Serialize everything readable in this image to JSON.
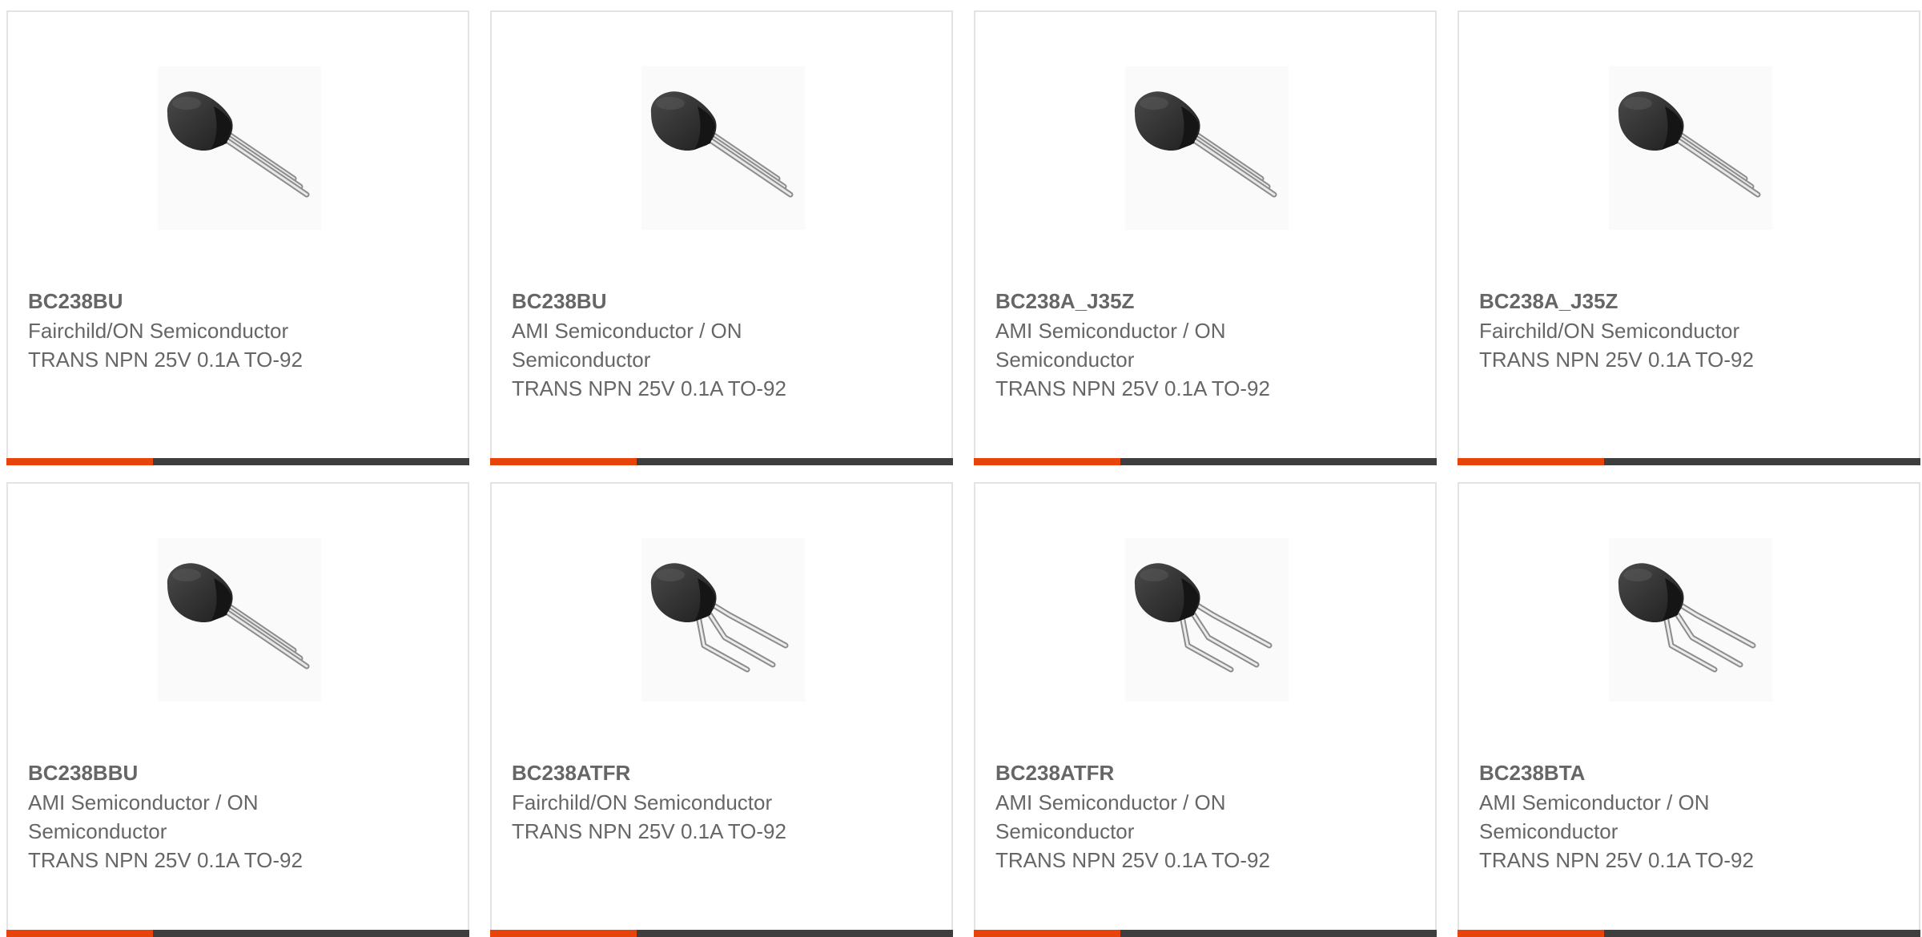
{
  "accent_color": "#e8430a",
  "bar_color": "#3e3e3e",
  "cards": [
    {
      "part_number": "BC238BU",
      "manufacturer": "Fairchild/ON Semiconductor",
      "description": "TRANS NPN 25V 0.1A TO-92",
      "image_icon": "to92-straight-leads-icon"
    },
    {
      "part_number": "BC238BU",
      "manufacturer": "AMI Semiconductor / ON Semiconductor",
      "description": "TRANS NPN 25V 0.1A TO-92",
      "image_icon": "to92-straight-leads-icon"
    },
    {
      "part_number": "BC238A_J35Z",
      "manufacturer": "AMI Semiconductor / ON Semiconductor",
      "description": "TRANS NPN 25V 0.1A TO-92",
      "image_icon": "to92-straight-leads-icon"
    },
    {
      "part_number": "BC238A_J35Z",
      "manufacturer": "Fairchild/ON Semiconductor",
      "description": "TRANS NPN 25V 0.1A TO-92",
      "image_icon": "to92-straight-leads-icon"
    },
    {
      "part_number": "BC238BBU",
      "manufacturer": "AMI Semiconductor / ON Semiconductor",
      "description": "TRANS NPN 25V 0.1A TO-92",
      "image_icon": "to92-straight-leads-icon"
    },
    {
      "part_number": "BC238ATFR",
      "manufacturer": "Fairchild/ON Semiconductor",
      "description": "TRANS NPN 25V 0.1A TO-92",
      "image_icon": "to92-formed-leads-icon"
    },
    {
      "part_number": "BC238ATFR",
      "manufacturer": "AMI Semiconductor / ON Semiconductor",
      "description": "TRANS NPN 25V 0.1A TO-92",
      "image_icon": "to92-formed-leads-icon"
    },
    {
      "part_number": "BC238BTA",
      "manufacturer": "AMI Semiconductor / ON Semiconductor",
      "description": "TRANS NPN 25V 0.1A TO-92",
      "image_icon": "to92-formed-leads-icon"
    }
  ]
}
